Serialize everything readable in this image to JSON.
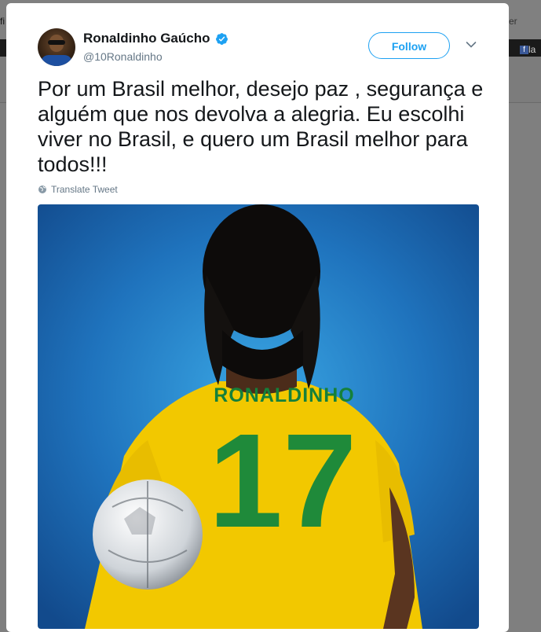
{
  "background": {
    "left_fragment": "fi",
    "right_fragment": "er",
    "fb_fragment": "la"
  },
  "tweet": {
    "author_name": "Ronaldinho Gaúcho",
    "handle": "@10Ronaldinho",
    "follow_label": "Follow",
    "text": "Por um Brasil melhor, desejo paz , segurança e alguém que nos devolva a alegria. Eu escolhi viver no Brasil, e quero um Brasil melhor para todos!!!",
    "translate_label": "Translate Tweet",
    "image": {
      "jersey_name": "RONALDINHO",
      "jersey_number": "17"
    }
  },
  "colors": {
    "accent": "#1da1f2",
    "jersey_yellow": "#f2c800",
    "jersey_green": "#1f8a3a",
    "background_blue": "#1e6fb8"
  },
  "icons": [
    "verified-badge-icon",
    "chevron-down-icon",
    "globe-icon"
  ]
}
